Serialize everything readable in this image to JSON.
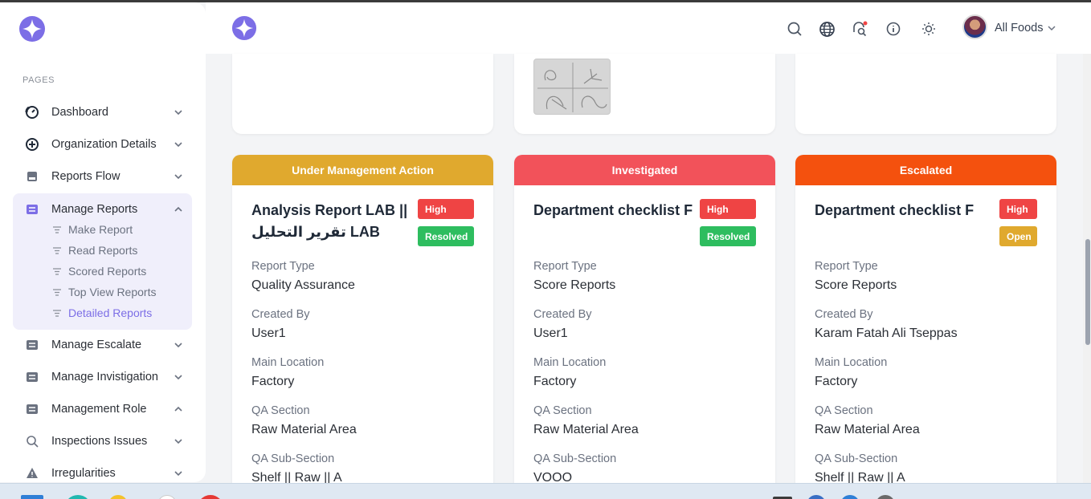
{
  "sidebar": {
    "section_label": "PAGES",
    "items": [
      {
        "label": "Dashboard"
      },
      {
        "label": "Organization Details"
      },
      {
        "label": "Reports Flow"
      },
      {
        "label": "Manage Reports"
      },
      {
        "label": "Manage Escalate"
      },
      {
        "label": "Manage Invistigation"
      },
      {
        "label": "Management Role"
      },
      {
        "label": "Inspections Issues"
      },
      {
        "label": "Irregularities"
      }
    ],
    "sub_items": [
      {
        "label": "Make Report"
      },
      {
        "label": "Read Reports"
      },
      {
        "label": "Scored Reports"
      },
      {
        "label": "Top View Reports"
      },
      {
        "label": "Detailed Reports"
      }
    ]
  },
  "header": {
    "account_name": "All Foods"
  },
  "colors": {
    "brand": "#7c6ee6",
    "under_management": "#e0a92e",
    "investigated": "#f2525a",
    "escalated": "#f4510e",
    "badge_high": "#ef4444",
    "badge_resolved": "#2ebd5f",
    "badge_open": "#e0a92e"
  },
  "labels": {
    "report_type": "Report Type",
    "created_by": "Created By",
    "main_location": "Main Location",
    "qa_section": "QA Section",
    "qa_sub_section": "QA Sub-Section"
  },
  "cards": [
    {
      "status": "Under Management Action",
      "title": "Analysis Report LAB || تقرير التحليل LAB",
      "priority": "High",
      "state": "Resolved",
      "report_type": "Quality Assurance",
      "created_by": "User1",
      "main_location": "Factory",
      "qa_section": "Raw Material Area",
      "qa_sub_section": "Shelf || Raw || A"
    },
    {
      "status": "Investigated",
      "title": "Department checklist F",
      "priority": "High",
      "state": "Resolved",
      "report_type": "Score Reports",
      "created_by": "User1",
      "main_location": "Factory",
      "qa_section": "Raw Material Area",
      "qa_sub_section": "VOOO"
    },
    {
      "status": "Escalated",
      "title": "Department checklist F",
      "priority": "High",
      "state": "Open",
      "report_type": "Score Reports",
      "created_by": "Karam Fatah Ali Tseppas",
      "main_location": "Factory",
      "qa_section": "Raw Material Area",
      "qa_sub_section": "Shelf || Raw || A"
    }
  ]
}
